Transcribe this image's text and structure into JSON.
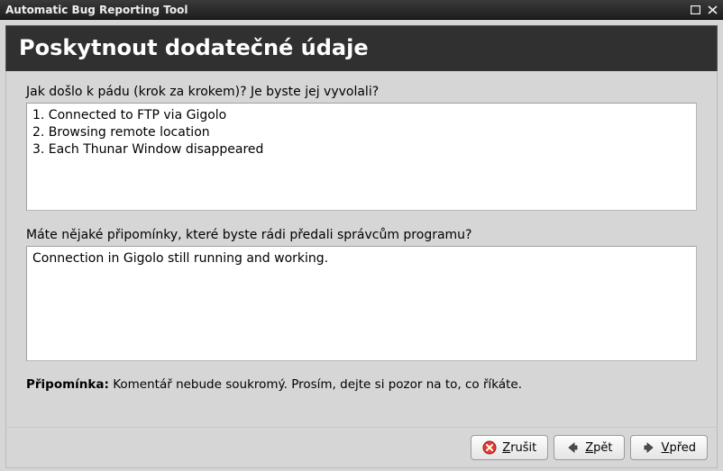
{
  "window": {
    "title": "Automatic Bug Reporting Tool"
  },
  "header": {
    "title": "Poskytnout dodatečné údaje"
  },
  "fields": {
    "steps": {
      "label": "Jak došlo k pádu (krok za krokem)? Je byste jej vyvolali?",
      "value": "1. Connected to FTP via Gigolo\n2. Browsing remote location\n3. Each Thunar Window disappeared"
    },
    "comments": {
      "label": "Máte nějaké připomínky, které byste rádi předali správcům programu?",
      "value": "Connection in Gigolo still running and working."
    }
  },
  "note": {
    "prefix": "Připomínka:",
    "text": " Komentář nebude soukromý. Prosím, dejte si pozor na to, co říkáte."
  },
  "buttons": {
    "cancel": "Zrušit",
    "back": "Zpět",
    "forward": "Vpřed"
  }
}
